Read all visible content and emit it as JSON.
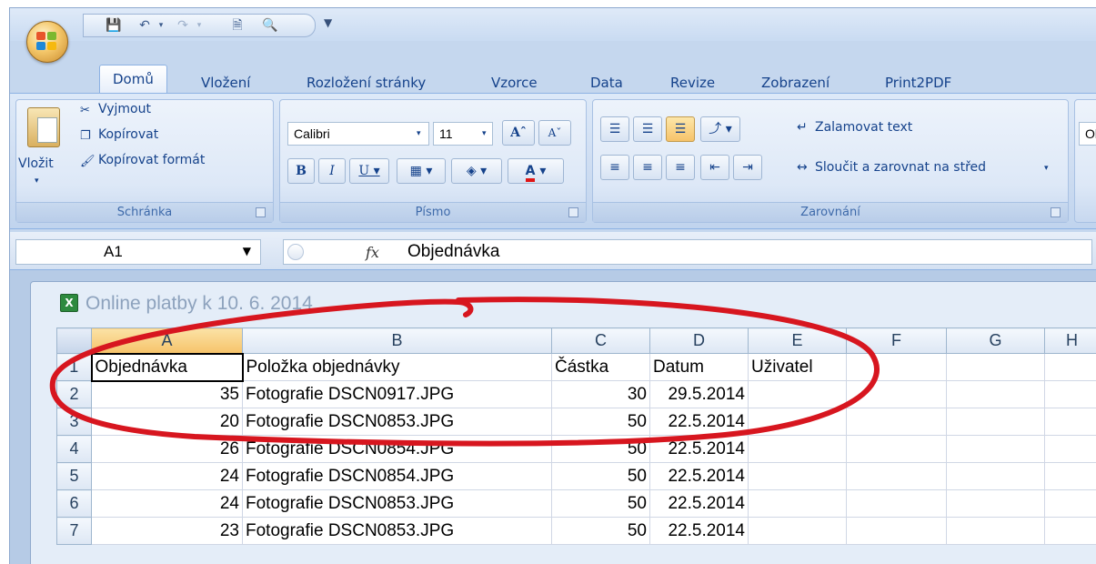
{
  "tabs": [
    "Domů",
    "Vložení",
    "Rozložení stránky",
    "Vzorce",
    "Data",
    "Revize",
    "Zobrazení",
    "Print2PDF"
  ],
  "clipboard": {
    "paste": "Vložit",
    "cut": "Vyjmout",
    "copy": "Kopírovat",
    "format_painter": "Kopírovat formát",
    "label": "Schránka"
  },
  "font": {
    "name": "Calibri",
    "size": "11",
    "label": "Písmo"
  },
  "alignment": {
    "wrap": "Zalamovat text",
    "merge": "Sloučit a zarovnat na střed",
    "label": "Zarovnání"
  },
  "next_group_peek": "Ob",
  "formula_bar": {
    "cell_ref": "A1",
    "fx": "fx",
    "value": "Objednávka"
  },
  "workbook_title": "Online platby k 10. 6. 2014",
  "sheet": {
    "columns": [
      "A",
      "B",
      "C",
      "D",
      "E",
      "F",
      "G",
      "H"
    ],
    "rows": [
      {
        "n": "1",
        "cells": [
          "Objednávka",
          "Položka objednávky",
          "Částka",
          "Datum",
          "Uživatel",
          "",
          "",
          ""
        ]
      },
      {
        "n": "2",
        "cells": [
          "35",
          "Fotografie DSCN0917.JPG",
          "30",
          "29.5.2014",
          "",
          "",
          "",
          ""
        ]
      },
      {
        "n": "3",
        "cells": [
          "20",
          "Fotografie DSCN0853.JPG",
          "50",
          "22.5.2014",
          "",
          "",
          "",
          ""
        ]
      },
      {
        "n": "4",
        "cells": [
          "26",
          "Fotografie DSCN0854.JPG",
          "50",
          "22.5.2014",
          "",
          "",
          "",
          ""
        ]
      },
      {
        "n": "5",
        "cells": [
          "24",
          "Fotografie DSCN0854.JPG",
          "50",
          "22.5.2014",
          "",
          "",
          "",
          ""
        ]
      },
      {
        "n": "6",
        "cells": [
          "24",
          "Fotografie DSCN0853.JPG",
          "50",
          "22.5.2014",
          "",
          "",
          "",
          ""
        ]
      },
      {
        "n": "7",
        "cells": [
          "23",
          "Fotografie DSCN0853.JPG",
          "50",
          "22.5.2014",
          "",
          "",
          "",
          ""
        ]
      }
    ]
  },
  "colors": {
    "accent_blue": "#15428b",
    "annotation_red": "#d7161f",
    "selected_header": "#f6c36a"
  }
}
